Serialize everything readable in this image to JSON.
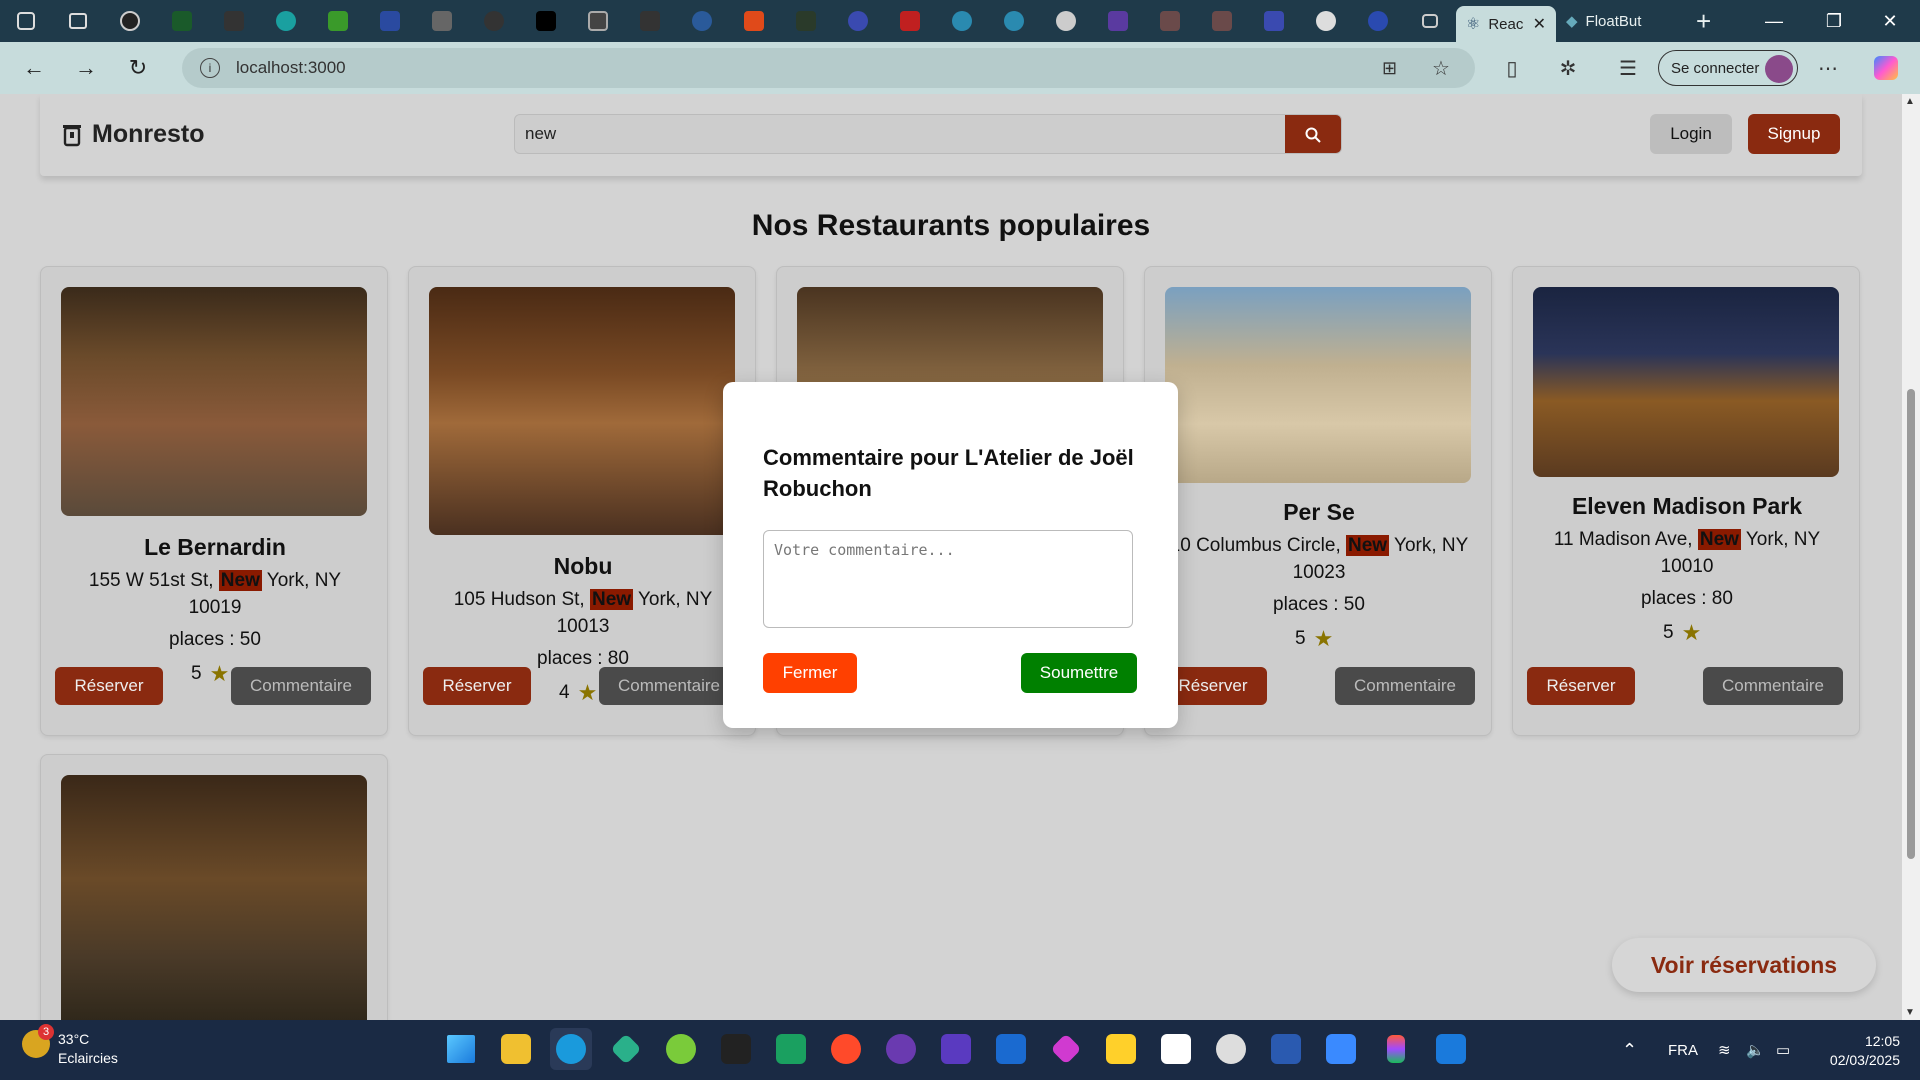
{
  "browser": {
    "tabs": [
      {
        "label": "Reac",
        "active": true
      },
      {
        "label": "FloatBut",
        "active": false
      }
    ],
    "url": "localhost:3000",
    "signin_label": "Se connecter"
  },
  "app": {
    "brand": "Monresto",
    "search_value": "new",
    "login_label": "Login",
    "signup_label": "Signup",
    "section_title": "Nos Restaurants populaires",
    "reserve_label": "Réserver",
    "comment_label": "Commentaire",
    "restaurants": [
      {
        "name": "Le Bernardin",
        "addr_pre": "155 W 51st St, ",
        "addr_hl": "New",
        "addr_post": " York, NY 10019",
        "places": "places : 50",
        "rating": "5"
      },
      {
        "name": "Nobu",
        "addr_pre": "105 Hudson St, ",
        "addr_hl": "New",
        "addr_post": " York, NY 10013",
        "places": "places : 80",
        "rating": "4"
      },
      {
        "name": "Per Se",
        "addr_pre": "10 Columbus Circle, ",
        "addr_hl": "New",
        "addr_post": " York, NY 10023",
        "places": "places : 50",
        "rating": "5"
      },
      {
        "name": "Eleven Madison Park",
        "addr_pre": "11 Madison Ave, ",
        "addr_hl": "New",
        "addr_post": " York, NY 10010",
        "places": "places : 80",
        "rating": "5"
      }
    ],
    "voir_label": "Voir réservations"
  },
  "modal": {
    "title": "Commentaire pour L'Atelier de Joël Robuchon",
    "placeholder": "Votre commentaire...",
    "close_label": "Fermer",
    "submit_label": "Soumettre"
  },
  "taskbar": {
    "temp": "33°C",
    "weather": "Eclaircies",
    "notif_count": "3",
    "lang": "FRA",
    "time": "12:05",
    "date": "02/03/2025"
  },
  "colors": {
    "accent": "#8a2a10",
    "close": "#ff4000",
    "submit": "#008000",
    "highlight": "#8a1a00"
  }
}
